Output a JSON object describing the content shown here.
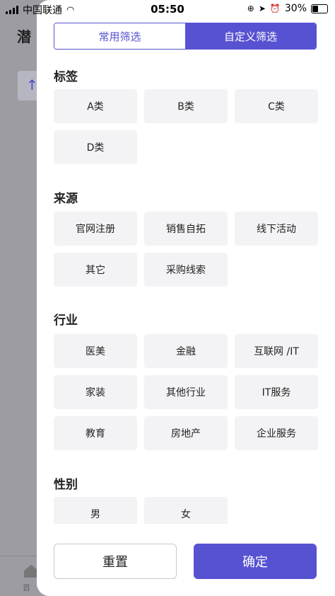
{
  "status_bar": {
    "carrier": "中国联通",
    "time": "05:50",
    "battery": "30%"
  },
  "background": {
    "page_title_partial": "潜",
    "tab_label_partial": "首"
  },
  "segmented": {
    "common": "常用筛选",
    "custom": "自定义筛选"
  },
  "groups": [
    {
      "title": "标签",
      "options": [
        "A类",
        "B类",
        "C类",
        "D类"
      ]
    },
    {
      "title": "来源",
      "options": [
        "官网注册",
        "销售自拓",
        "线下活动",
        "其它",
        "采购线索"
      ]
    },
    {
      "title": "行业",
      "options": [
        "医美",
        "金融",
        "互联网 /IT",
        "家装",
        "其他行业",
        "IT服务",
        "教育",
        "房地产",
        "企业服务"
      ]
    },
    {
      "title": "性别",
      "options": [
        "男",
        "女"
      ]
    }
  ],
  "footer": {
    "reset": "重置",
    "confirm": "确定"
  },
  "colors": {
    "accent": "#5752d1",
    "tag_bg": "#f3f3f5"
  }
}
